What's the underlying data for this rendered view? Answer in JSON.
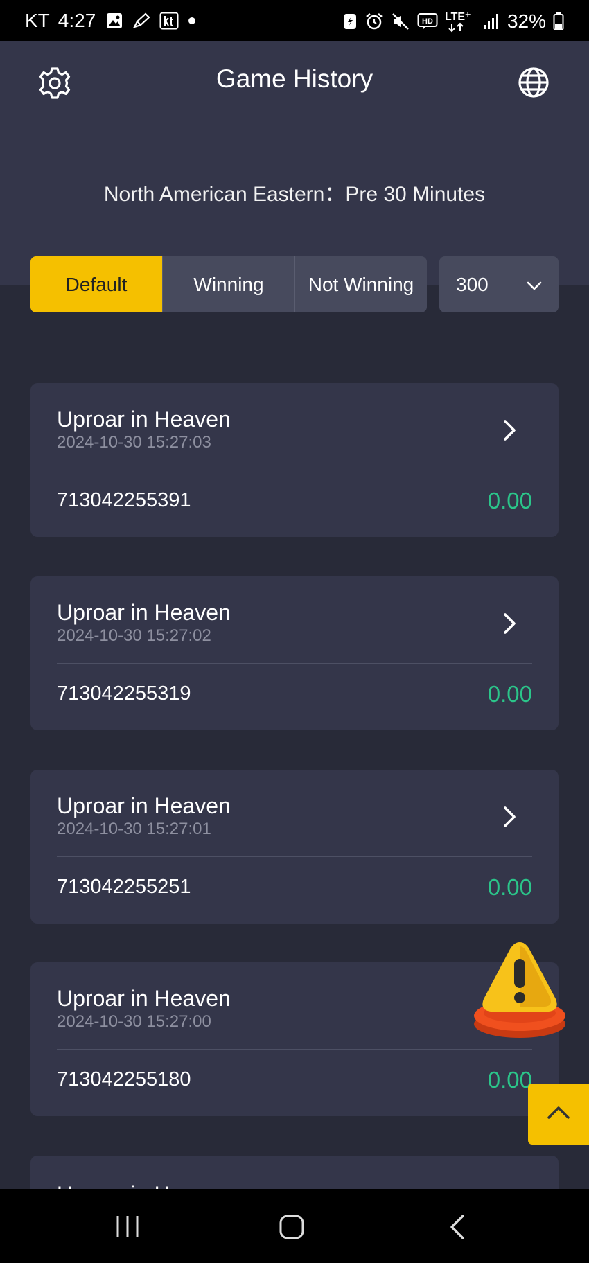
{
  "status_bar": {
    "carrier": "KT",
    "time": "4:27",
    "network": "LTE+",
    "battery": "32%"
  },
  "header": {
    "title": "Game History",
    "settings_icon": "gear-icon",
    "language_icon": "globe-icon"
  },
  "timezone": {
    "label": "North American Eastern：Pre 30 Minutes"
  },
  "filters": {
    "tabs": [
      {
        "label": "Default",
        "active": true
      },
      {
        "label": "Winning",
        "active": false
      },
      {
        "label": "Not Winning",
        "active": false
      }
    ],
    "count": "300"
  },
  "records": [
    {
      "game": "Uproar in Heaven",
      "time": "2024-10-30 15:27:03",
      "round": "713042255391",
      "amount": "0.00"
    },
    {
      "game": "Uproar in Heaven",
      "time": "2024-10-30 15:27:02",
      "round": "713042255319",
      "amount": "0.00"
    },
    {
      "game": "Uproar in Heaven",
      "time": "2024-10-30 15:27:01",
      "round": "713042255251",
      "amount": "0.00"
    },
    {
      "game": "Uproar in Heaven",
      "time": "2024-10-30 15:27:00",
      "round": "713042255180",
      "amount": "0.00"
    },
    {
      "game": "Uproar in Heaven"
    }
  ],
  "colors": {
    "accent": "#f5c000",
    "win_amount": "#2bc58a",
    "background": "#282a38",
    "card": "#34364a"
  }
}
